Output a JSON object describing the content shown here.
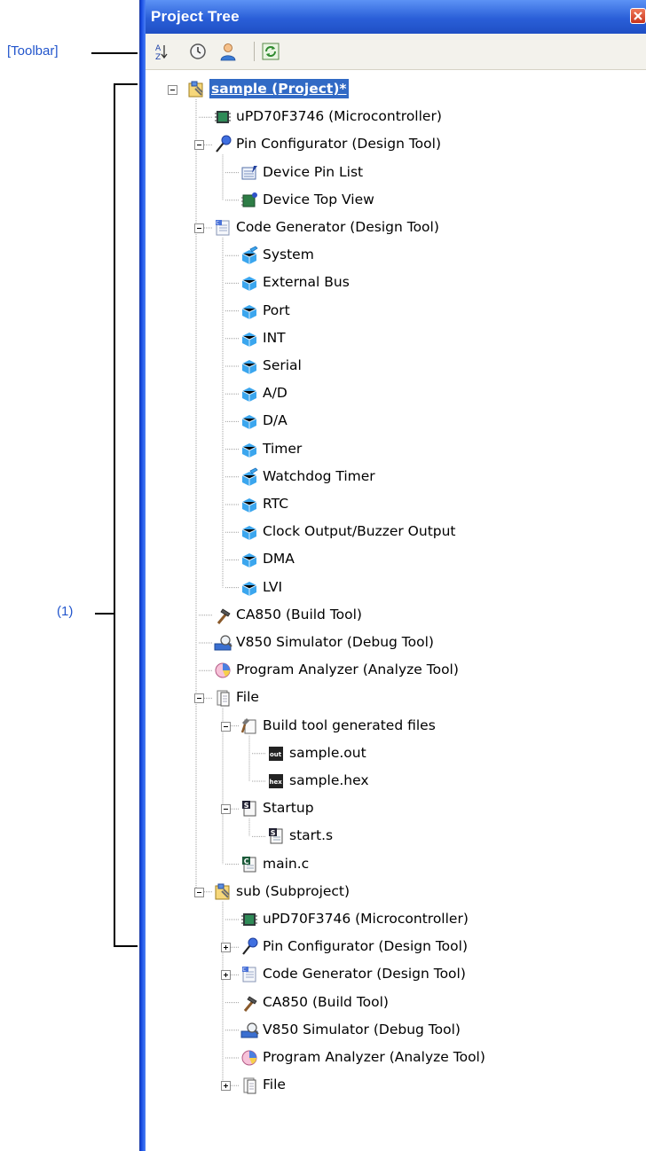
{
  "annotations": {
    "toolbar_label": "[Toolbar]",
    "tree_label": "(1)"
  },
  "panel": {
    "title": "Project Tree"
  },
  "toolbar": {
    "buttons": [
      {
        "icon": "sort-az-icon"
      },
      {
        "icon": "clock-icon"
      },
      {
        "icon": "user-icon"
      },
      {
        "icon": "refresh-icon"
      }
    ]
  },
  "tree": {
    "rows": [
      {
        "label": "sample (Project)*",
        "depth": 0,
        "icon": "project-icon",
        "expander": "minus",
        "selected": true
      },
      {
        "label": "uPD70F3746 (Microcontroller)",
        "depth": 1,
        "icon": "chip-icon"
      },
      {
        "label": "Pin Configurator (Design Tool)",
        "depth": 1,
        "icon": "pin-icon",
        "expander": "minus"
      },
      {
        "label": "Device Pin List",
        "depth": 2,
        "icon": "pin-list-icon"
      },
      {
        "label": "Device Top View",
        "depth": 2,
        "icon": "top-view-icon"
      },
      {
        "label": "Code Generator (Design Tool)",
        "depth": 1,
        "icon": "code-generator-icon",
        "expander": "minus"
      },
      {
        "label": "System",
        "depth": 2,
        "icon": "module-edit-icon"
      },
      {
        "label": "External Bus",
        "depth": 2,
        "icon": "module-icon"
      },
      {
        "label": "Port",
        "depth": 2,
        "icon": "module-icon"
      },
      {
        "label": "INT",
        "depth": 2,
        "icon": "module-icon"
      },
      {
        "label": "Serial",
        "depth": 2,
        "icon": "module-icon"
      },
      {
        "label": "A/D",
        "depth": 2,
        "icon": "module-icon"
      },
      {
        "label": "D/A",
        "depth": 2,
        "icon": "module-icon"
      },
      {
        "label": "Timer",
        "depth": 2,
        "icon": "module-icon"
      },
      {
        "label": "Watchdog Timer",
        "depth": 2,
        "icon": "module-edit-icon"
      },
      {
        "label": "RTC",
        "depth": 2,
        "icon": "module-icon"
      },
      {
        "label": "Clock Output/Buzzer Output",
        "depth": 2,
        "icon": "module-icon"
      },
      {
        "label": "DMA",
        "depth": 2,
        "icon": "module-icon"
      },
      {
        "label": "LVI",
        "depth": 2,
        "icon": "module-icon"
      },
      {
        "label": "CA850 (Build Tool)",
        "depth": 1,
        "icon": "hammer-icon"
      },
      {
        "label": "V850 Simulator (Debug Tool)",
        "depth": 1,
        "icon": "debug-icon"
      },
      {
        "label": "Program Analyzer (Analyze Tool)",
        "depth": 1,
        "icon": "analyzer-icon"
      },
      {
        "label": "File",
        "depth": 1,
        "icon": "file-icon",
        "expander": "minus"
      },
      {
        "label": "Build tool generated files",
        "depth": 2,
        "icon": "build-files-icon",
        "expander": "minus"
      },
      {
        "label": "sample.out",
        "depth": 3,
        "icon": "out-file-icon"
      },
      {
        "label": "sample.hex",
        "depth": 3,
        "icon": "hex-file-icon"
      },
      {
        "label": "Startup",
        "depth": 2,
        "icon": "startup-icon",
        "expander": "minus"
      },
      {
        "label": "start.s",
        "depth": 3,
        "icon": "asm-file-icon"
      },
      {
        "label": "main.c",
        "depth": 2,
        "icon": "c-file-icon"
      },
      {
        "label": "sub (Subproject)",
        "depth": 1,
        "icon": "project-icon",
        "expander": "minus"
      },
      {
        "label": "uPD70F3746 (Microcontroller)",
        "depth": 2,
        "icon": "chip-icon"
      },
      {
        "label": "Pin Configurator (Design Tool)",
        "depth": 2,
        "icon": "pin-icon",
        "expander": "plus"
      },
      {
        "label": "Code Generator (Design Tool)",
        "depth": 2,
        "icon": "code-generator-icon",
        "expander": "plus"
      },
      {
        "label": "CA850 (Build Tool)",
        "depth": 2,
        "icon": "hammer-icon"
      },
      {
        "label": "V850 Simulator (Debug Tool)",
        "depth": 2,
        "icon": "debug-icon"
      },
      {
        "label": "Program Analyzer (Analyze Tool)",
        "depth": 2,
        "icon": "analyzer-icon"
      },
      {
        "label": "File",
        "depth": 2,
        "icon": "file-icon",
        "expander": "plus"
      }
    ]
  }
}
